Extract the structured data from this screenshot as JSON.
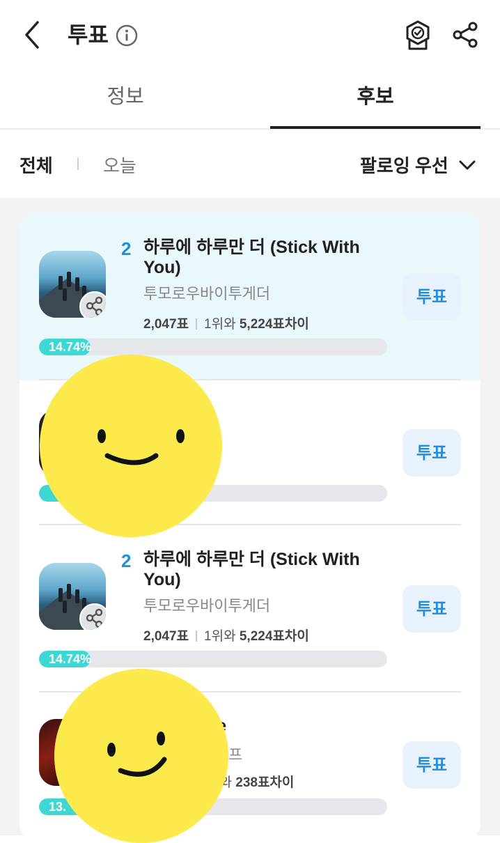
{
  "header": {
    "title": "투표"
  },
  "tabs": [
    {
      "label": "정보"
    },
    {
      "label": "후보"
    }
  ],
  "filters": {
    "all": "전체",
    "today": "오늘",
    "sort": "팔로잉 우선"
  },
  "candidates": [
    {
      "rank": "2",
      "title": "하루에 하루만 더 (Stick With You)",
      "artist": "투모로우바이투게더",
      "votes": "2,047표",
      "gap_rank": "1위와 ",
      "gap_votes": "5,224표차이",
      "percent_label": "14.74%",
      "percent": 14.74,
      "vote_label": "투표"
    },
    {
      "percent": 46.0,
      "vote_label": "투표"
    },
    {
      "rank": "2",
      "title": "하루에 하루만 더 (Stick With You)",
      "artist": "투모로우바이투게더",
      "votes": "2,047표",
      "gap_rank": "1위와 ",
      "gap_votes": "5,224표차이",
      "percent_label": "14.74%",
      "percent": 14.74,
      "vote_label": "투표"
    },
    {
      "title_partial": "he",
      "artist_partial": "프",
      "gap_rank": "위와 ",
      "gap_votes": "238표차이",
      "percent_label": "13.",
      "percent": 13.0,
      "vote_label": "투표"
    }
  ]
}
